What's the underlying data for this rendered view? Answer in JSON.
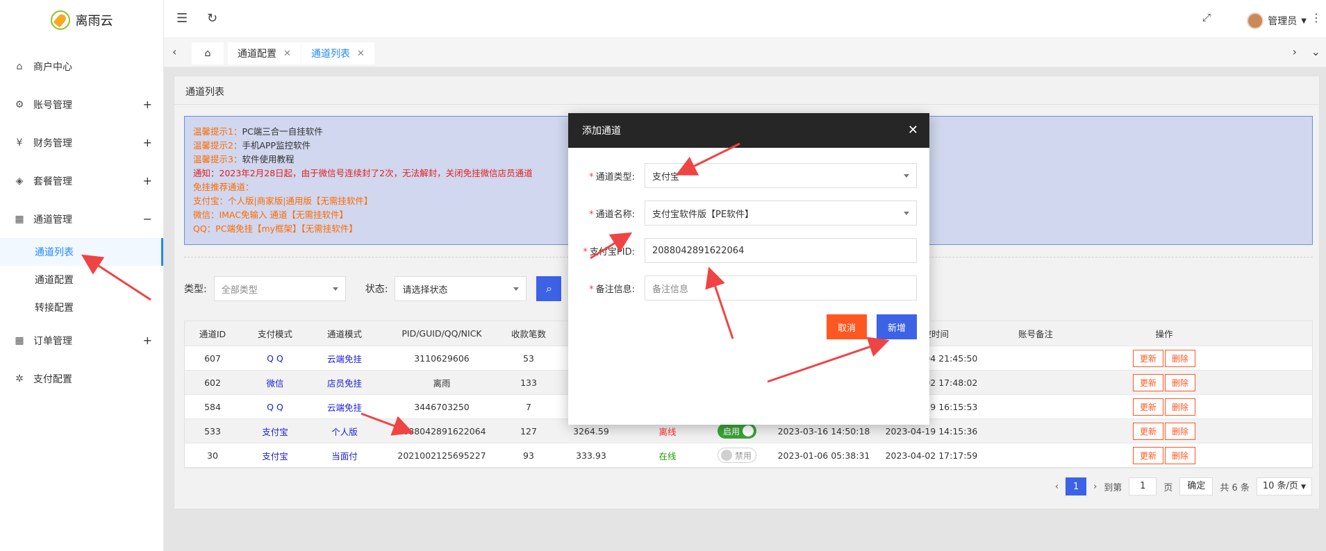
{
  "app": {
    "logo_text": "离雨云"
  },
  "sidebar": {
    "items": [
      {
        "label": "商户中心",
        "icon": "home-icon",
        "expand": ""
      },
      {
        "label": "账号管理",
        "icon": "gear-icon",
        "expand": "+"
      },
      {
        "label": "财务管理",
        "icon": "finance-icon",
        "expand": "+"
      },
      {
        "label": "套餐管理",
        "icon": "box-icon",
        "expand": "+"
      },
      {
        "label": "通道管理",
        "icon": "grid-icon",
        "expand": "−"
      }
    ],
    "sub_items": [
      {
        "label": "通道列表"
      },
      {
        "label": "通道配置"
      },
      {
        "label": "转接配置"
      }
    ],
    "items_after": [
      {
        "label": "订单管理",
        "icon": "grid-icon",
        "expand": "+"
      },
      {
        "label": "支付配置",
        "icon": "settings-icon",
        "expand": ""
      }
    ]
  },
  "topbar": {
    "user_name": "管理员"
  },
  "tabs": [
    {
      "label": "通道配置",
      "close": "✕"
    },
    {
      "label": "通道列表",
      "close": "✕"
    }
  ],
  "page": {
    "title": "通道列表",
    "notices": [
      {
        "prefix": "温馨提示1：",
        "text": "PC端三合一自挂软件"
      },
      {
        "prefix": "温馨提示2：",
        "text": "手机APP监控软件"
      },
      {
        "prefix": "温馨提示3：",
        "text": "软件使用教程"
      },
      {
        "prefix": "",
        "text": "通知：2023年2月28日起，由于微信号连续封了2次，无法解封，关闭免挂微信店员通道"
      },
      {
        "prefix": "",
        "text": "免挂推荐通道："
      },
      {
        "prefix": "",
        "text": "支付宝：个人版|商家版|通用版【无需挂软件】"
      },
      {
        "prefix": "",
        "text": "微信：IMAC免输入 通道【无需挂软件】"
      },
      {
        "prefix": "",
        "text": "QQ：PC端免挂【my框架】【无需挂软件】"
      }
    ]
  },
  "filter": {
    "type_label": "类型:",
    "type_value": "全部类型",
    "status_label": "状态:",
    "status_value": "请选择状态"
  },
  "table": {
    "headers": [
      "通道ID",
      "支付模式",
      "通道模式",
      "PID/GUID/QQ/NICK",
      "收款笔数",
      "",
      "",
      "",
      "",
      "监控时间",
      "账号备注",
      "操作"
    ],
    "rows": [
      {
        "id": "607",
        "pay": "Q Q",
        "mode": "云端免挂",
        "pid": "3110629606",
        "count": "53",
        "amount": "",
        "status": "",
        "switch": "",
        "created": "",
        "monitor": "2023-04-04 21:45:50",
        "note": ""
      },
      {
        "id": "602",
        "pay": "微信",
        "mode": "店员免挂",
        "pid": "离雨",
        "count": "133",
        "amount": "",
        "status": "",
        "switch": "",
        "created": "",
        "monitor": "2023-04-02 17:48:02",
        "note": ""
      },
      {
        "id": "584",
        "pay": "Q Q",
        "mode": "云端免挂",
        "pid": "3446703250",
        "count": "7",
        "amount": "",
        "status": "",
        "switch": "",
        "created": "",
        "monitor": "2023-04-19 16:15:53",
        "note": ""
      },
      {
        "id": "533",
        "pay": "支付宝",
        "mode": "个人版",
        "pid": "2088042891622064",
        "count": "127",
        "amount": "3264.59",
        "status": "离线",
        "switch": "启用",
        "created": "2023-03-16 14:50:18",
        "monitor": "2023-04-19 14:15:36",
        "note": ""
      },
      {
        "id": "30",
        "pay": "支付宝",
        "mode": "当面付",
        "pid": "2021002125695227",
        "count": "93",
        "amount": "333.93",
        "status": "在线",
        "switch": "禁用",
        "created": "2023-01-06 05:38:31",
        "monitor": "2023-04-02 17:17:59",
        "note": ""
      }
    ],
    "op_update": "更新",
    "op_delete": "删除"
  },
  "pager": {
    "current": "1",
    "goto_label": "到第",
    "goto_value": "1",
    "page_label": "页",
    "confirm": "确定",
    "total": "共 6 条",
    "size": "10 条/页"
  },
  "modal": {
    "title": "添加通道",
    "fields": [
      {
        "label": "通道类型:",
        "value": "支付宝",
        "placeholder": ""
      },
      {
        "label": "通道名称:",
        "value": "支付宝软件版【PE软件】",
        "placeholder": ""
      },
      {
        "label": "支付宝PID:",
        "value": "2088042891622064",
        "placeholder": ""
      },
      {
        "label": "备注信息:",
        "value": "",
        "placeholder": "备注信息"
      }
    ],
    "cancel": "取消",
    "submit": "新增"
  },
  "colors": {
    "primary": "#3c62e6",
    "danger": "#ff5722",
    "active_link": "#1e88ff",
    "notice_bg": "#d0d7ee",
    "modal_header": "#262626",
    "annotation_arrow": "#ef4444"
  }
}
